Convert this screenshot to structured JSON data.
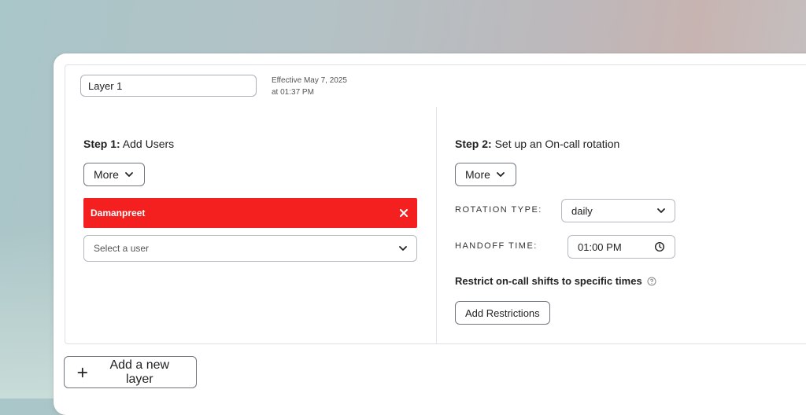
{
  "layer": {
    "name_value": "Layer 1",
    "effective_line1": "Effective May 7, 2025",
    "effective_line2": "at 01:37 PM"
  },
  "step1": {
    "title_bold": "Step 1:",
    "title_rest": " Add Users",
    "more_label": "More",
    "selected_user": "Damanpreet",
    "select_placeholder": "Select a user"
  },
  "step2": {
    "title_bold": "Step 2:",
    "title_rest": " Set up an On-call rotation",
    "more_label": "More",
    "rotation_type_label": "ROTATION TYPE:",
    "rotation_type_value": "daily",
    "handoff_time_label": "HANDOFF TIME:",
    "handoff_time_value": "01:00 PM",
    "restrict_label": "Restrict on-call shifts to specific times",
    "add_restrictions_label": "Add Restrictions"
  },
  "footer": {
    "add_layer_label": "Add a new layer"
  },
  "colors": {
    "user_chip": "#f42020",
    "border": "#6f7680"
  }
}
